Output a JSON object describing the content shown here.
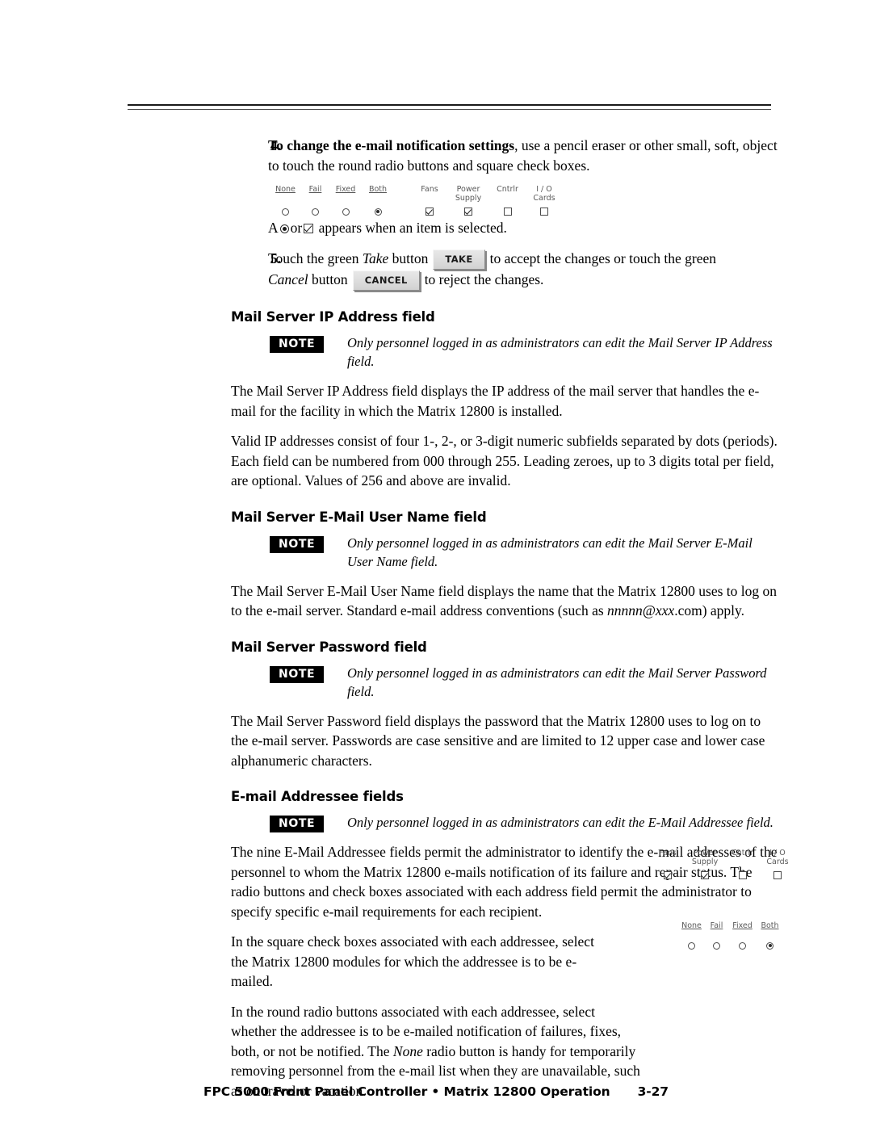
{
  "document": {
    "footer_title": "FPC 5000 Front Panel Controller • Matrix 12800 Operation",
    "page_number": "3-27"
  },
  "steps": [
    {
      "number": "4.",
      "lead": "To change the e-mail notification settings",
      "rest": ", use a pencil eraser or other small, soft, object to touch the round radio buttons and square check boxes.",
      "caption_prefix": "A",
      "caption_mid": "or",
      "caption_suffix": "appears when an item is selected."
    },
    {
      "number": "5.",
      "part1": "Touch the green",
      "take_italic": "Take",
      "part2": "button",
      "take_button": "TAKE",
      "part3": "to accept the changes or touch the green",
      "cancel_italic": "Cancel",
      "part4": "button",
      "cancel_button": "CANCEL",
      "part5": "to reject the changes."
    }
  ],
  "panel_graphic": {
    "radio_labels": [
      "None",
      "Fail",
      "Fixed",
      "Both"
    ],
    "radio_states": [
      false,
      false,
      false,
      true
    ],
    "check_labels": [
      "Fans",
      "Power Supply",
      "Cntrlr",
      "I / O Cards"
    ],
    "check_states": [
      true,
      true,
      false,
      false
    ]
  },
  "sections": [
    {
      "heading": "Mail Server IP Address field",
      "note_badge": "NOTE",
      "note_text": "Only personnel logged in as administrators can edit the Mail Server IP Address field.",
      "paragraphs": [
        "The Mail Server IP Address field displays the IP address of the mail server that handles the e-mail for the facility in which the Matrix 12800 is installed.",
        "Valid IP addresses consist of four 1-, 2-, or 3-digit numeric subfields separated by dots (periods).  Each field can be numbered from 000 through 255.  Leading zeroes, up to 3 digits total per field, are optional.  Values of 256 and above are invalid."
      ]
    },
    {
      "heading": "Mail Server E-Mail User Name field",
      "note_badge": "NOTE",
      "note_text": "Only personnel logged in as administrators can edit the Mail Server E-Mail User Name field.",
      "para_a": "The Mail Server E-Mail User Name field displays the name that the Matrix 12800 uses to log on to the e-mail server.  Standard e-mail address conventions (such as",
      "para_a_italic": "nnnnn@xxx",
      "para_a_end": ".com) apply."
    },
    {
      "heading": "Mail Server Password field",
      "note_badge": "NOTE",
      "note_text": "Only personnel logged in as administrators can edit the Mail Server Password field.",
      "paragraphs": [
        "The Mail Server Password field displays the password that the Matrix 12800 uses to log on to the e-mail server.  Passwords are case sensitive and are limited to 12 upper case and lower case alphanumeric characters."
      ]
    },
    {
      "heading": "E-mail Addressee fields",
      "note_badge": "NOTE",
      "note_text": "Only personnel logged in as administrators can edit the E-Mail Addressee field.",
      "paragraphs": [
        "The nine E-Mail Addressee fields permit the administrator to identify the e-mail addresses of the personnel to whom the Matrix 12800 e-mails notification of its failure and repair status.  The radio buttons and check boxes associated with each address field permit the administrator to specify specific e-mail requirements for each recipient.",
        "In the square check boxes associated with each addressee, select the Matrix 12800 modules for which the addressee is to be e-mailed."
      ],
      "para_radio_a": "In the round radio buttons associated with each addressee, select whether the addressee is to be e-mailed notification of failures, fixes, both, or not be notified.  The",
      "para_radio_italic": "None",
      "para_radio_b": "radio button is handy for temporarily removing personnel from the e-mail list when they are unavailable, such as on travel or vacation."
    }
  ],
  "side_checkbox_graphic": {
    "labels": [
      "Fans",
      "Power Supply",
      "Cntrlr",
      "I / O Cards"
    ],
    "states": [
      true,
      true,
      false,
      false
    ]
  },
  "side_radio_graphic": {
    "labels": [
      "None",
      "Fail",
      "Fixed",
      "Both"
    ],
    "states": [
      false,
      false,
      false,
      true
    ]
  }
}
